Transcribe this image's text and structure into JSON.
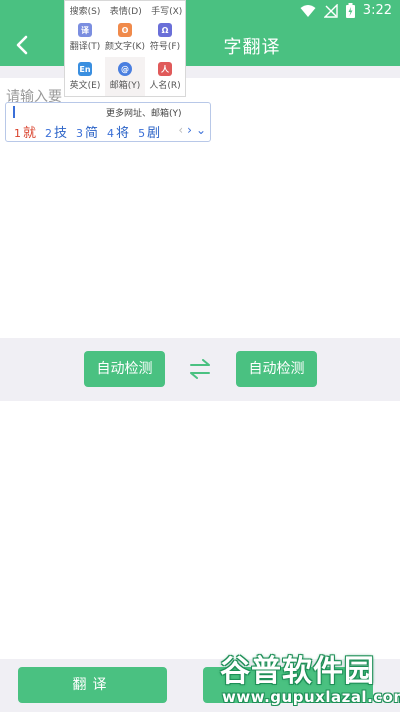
{
  "status_bar": {
    "time": "3:22"
  },
  "app_bar": {
    "title": "字翻译"
  },
  "input": {
    "placeholder": "请输入要"
  },
  "ime_candidates": {
    "hint": "更多网址、邮箱(Y)",
    "items": [
      {
        "num": "1",
        "word": "就"
      },
      {
        "num": "2",
        "word": "技"
      },
      {
        "num": "3",
        "word": "简"
      },
      {
        "num": "4",
        "word": "将"
      },
      {
        "num": "5",
        "word": "剧"
      }
    ]
  },
  "ime_panel": {
    "top_row": [
      "搜索(S)",
      "表情(D)",
      "手写(X)"
    ],
    "cells": [
      {
        "label": "翻译(T)",
        "icon": "translate-icon",
        "color": "#7b8ee0"
      },
      {
        "label": "颜文字(K)",
        "icon": "kaomoji-icon",
        "color": "#f08a4b"
      },
      {
        "label": "符号(F)",
        "icon": "omega-icon",
        "color": "#6a6fd8"
      },
      {
        "label": "英文(E)",
        "icon": "english-icon",
        "color": "#3a8fe0"
      },
      {
        "label": "邮箱(Y)",
        "icon": "at-icon",
        "color": "#4a7fe0"
      },
      {
        "label": "人名(R)",
        "icon": "person-icon",
        "color": "#e05a5a"
      }
    ]
  },
  "language": {
    "source": "自动检测",
    "target": "自动检测"
  },
  "actions": {
    "translate": "翻译"
  },
  "watermark": {
    "title": "谷普软件园",
    "url": "www.gupuxlazal.com"
  },
  "colors": {
    "accent": "#4ac181",
    "band": "#f0eff4"
  }
}
